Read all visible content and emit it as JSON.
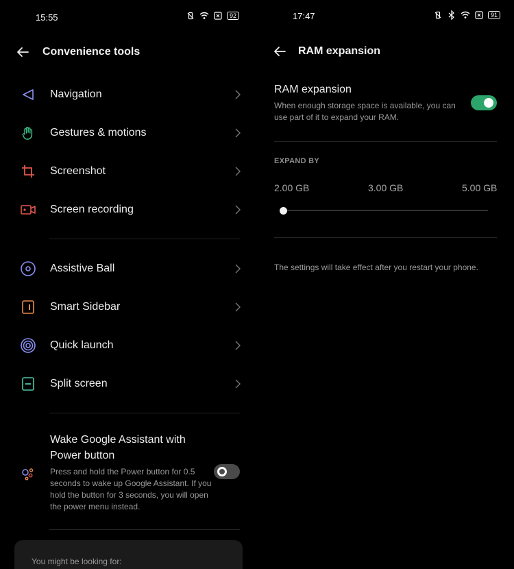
{
  "left": {
    "status": {
      "time": "15:55",
      "battery": "92"
    },
    "title": "Convenience tools",
    "items": [
      {
        "label": "Navigation",
        "icon": "navigation-icon"
      },
      {
        "label": "Gestures & motions",
        "icon": "hand-gesture-icon"
      },
      {
        "label": "Screenshot",
        "icon": "crop-icon"
      },
      {
        "label": "Screen recording",
        "icon": "video-camera-icon"
      },
      {
        "label": "Assistive Ball",
        "icon": "assistive-ball-icon"
      },
      {
        "label": "Smart Sidebar",
        "icon": "sidebar-icon"
      },
      {
        "label": "Quick launch",
        "icon": "quick-launch-icon"
      },
      {
        "label": "Split screen",
        "icon": "split-screen-icon"
      }
    ],
    "wake": {
      "title": "Wake Google Assistant with Power button",
      "desc": "Press and hold the Power button for 0.5 seconds to wake up Google Assistant. If you hold the button for 3 seconds, you will open the power menu instead.",
      "enabled": false
    },
    "card_text": "You might be looking for:"
  },
  "right": {
    "status": {
      "time": "17:47",
      "battery": "91"
    },
    "title": "RAM expansion",
    "ram_title": "RAM expansion",
    "ram_desc": "When enough storage space is available, you can use part of it to expand your RAM.",
    "enabled": true,
    "expand_heading": "EXPAND BY",
    "options": [
      "2.00 GB",
      "3.00 GB",
      "5.00 GB"
    ],
    "selected_option": "2.00 GB",
    "note": "The settings will take effect after you restart your phone."
  },
  "colors": {
    "toggle_on": "#2ca56a",
    "icon_blue": "#8a8ff2",
    "icon_green": "#3fc38a",
    "icon_red": "#e1584e",
    "icon_orange": "#e98a4a",
    "icon_teal": "#4cc6a8"
  }
}
